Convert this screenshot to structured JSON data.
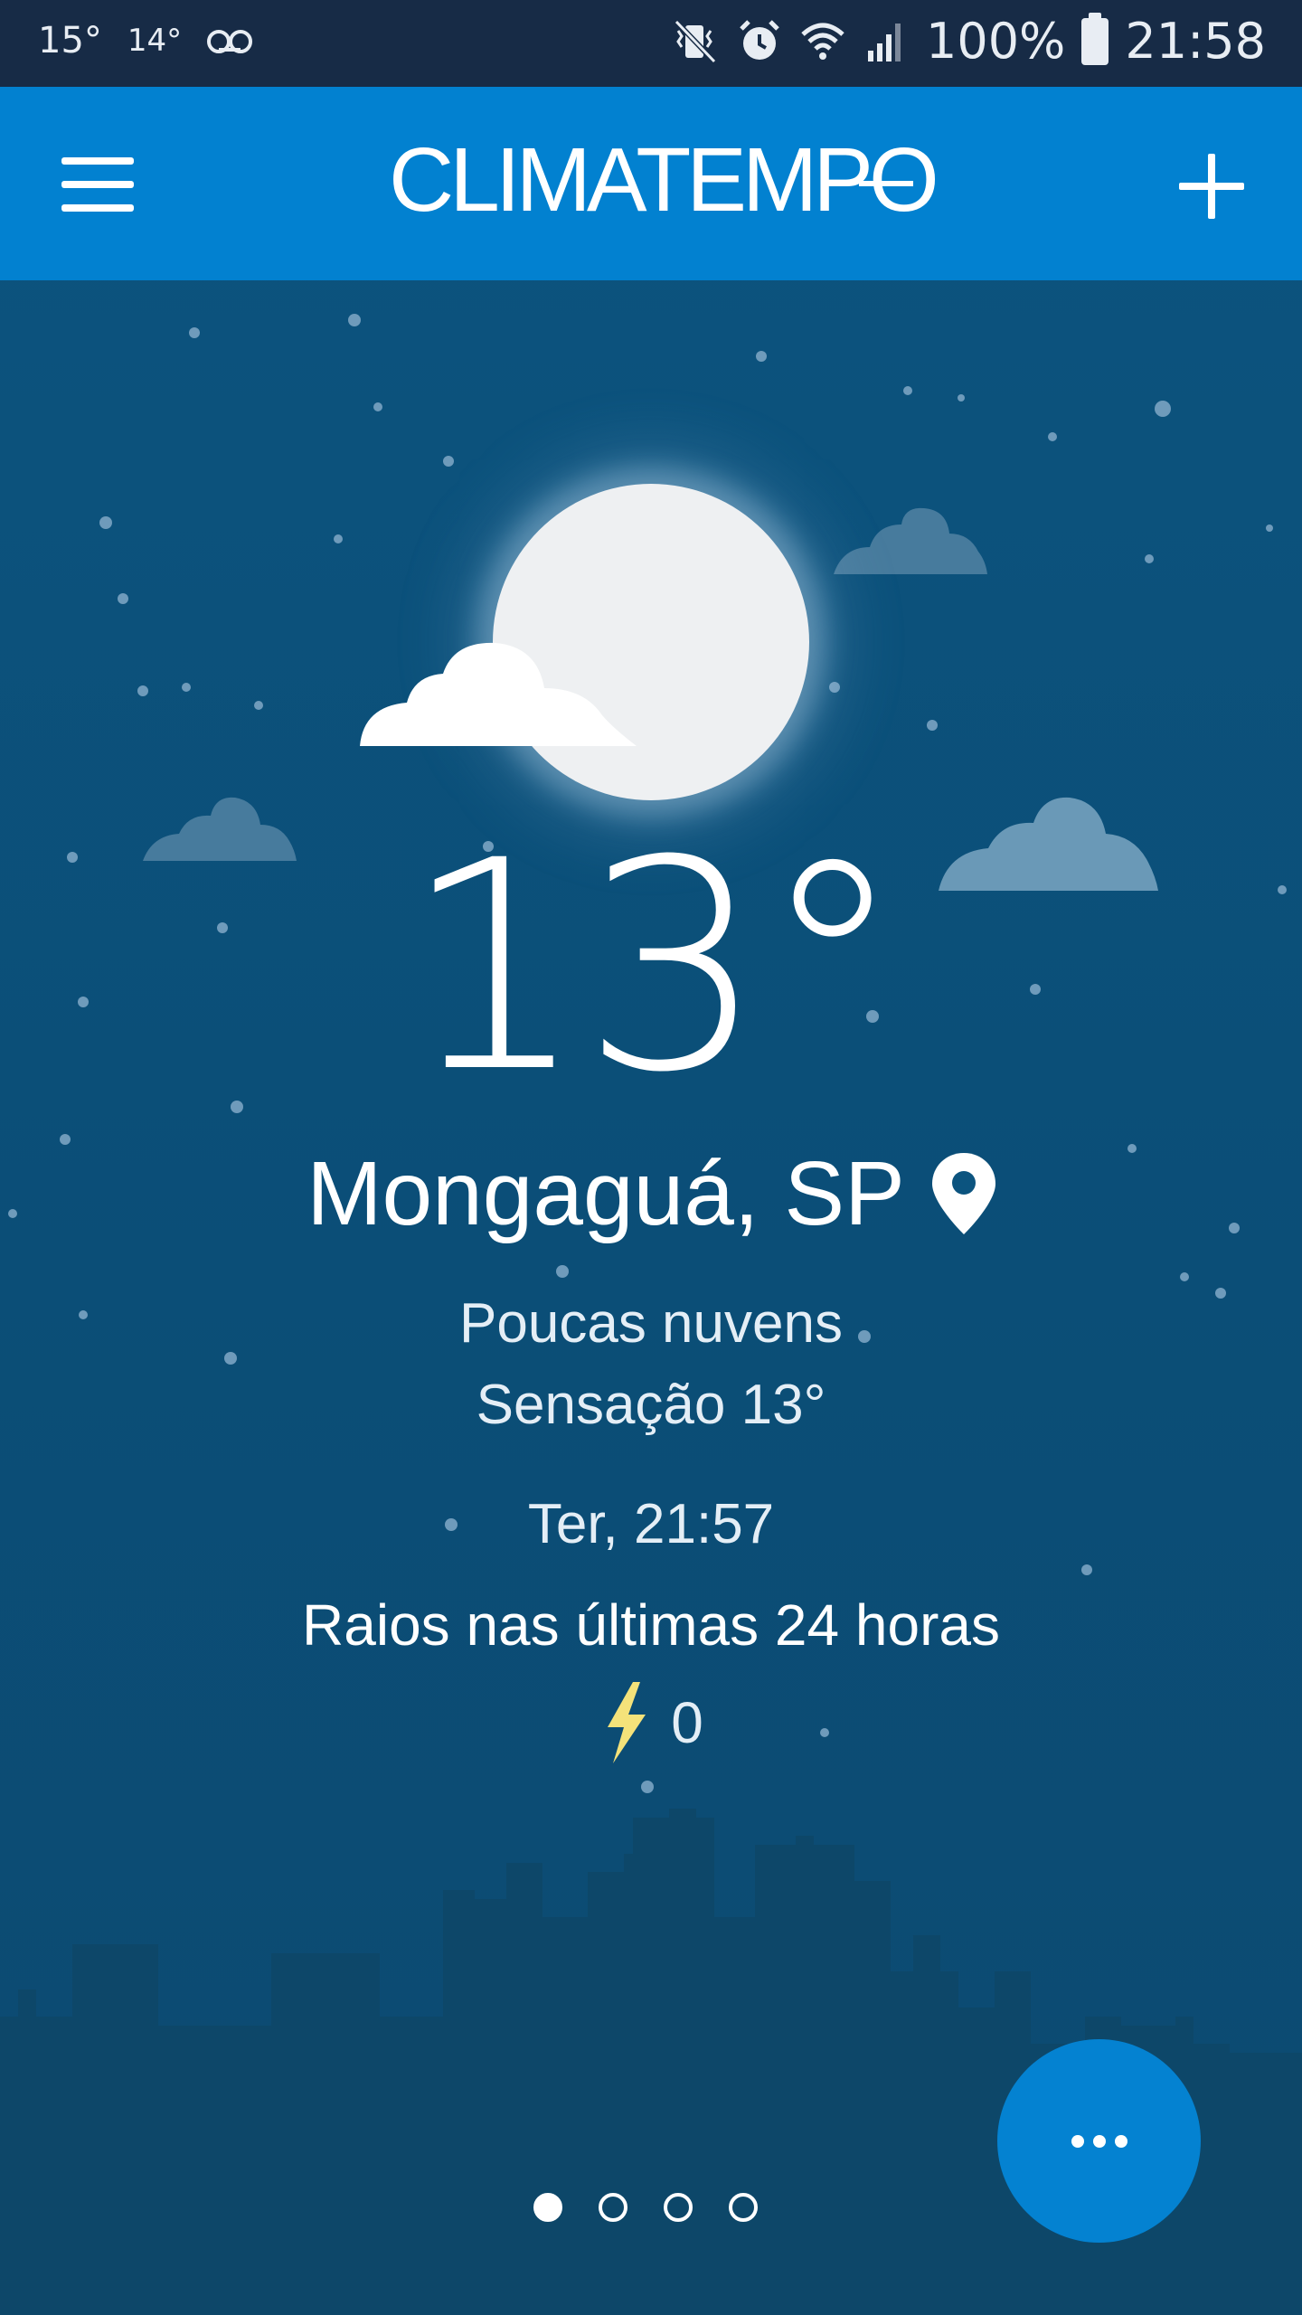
{
  "status_bar": {
    "temp1": "15°",
    "temp2": "14°",
    "voicemail_icon": "voicemail-icon",
    "battery": "100%",
    "time": "21:58",
    "icons": [
      "mute-vibrate-icon",
      "alarm-icon",
      "wifi-icon",
      "signal-icon",
      "battery-icon"
    ]
  },
  "app_bar": {
    "logo_text": "CLIMATEMPO",
    "menu_icon": "hamburger-icon",
    "add_icon": "plus-icon"
  },
  "weather": {
    "temperature": "13°",
    "city": "Mongaguá, SP",
    "condition": "Poucas nuvens",
    "feels_like": "Sensação 13°",
    "datetime": "Ter, 21:57",
    "lightning_title": "Raios nas últimas 24 horas",
    "lightning_count": "0"
  },
  "pager": {
    "pages": 4,
    "active_index": 0
  },
  "colors": {
    "status_bar": "#172b46",
    "app_bar": "#0281d0",
    "background": "#0c547f",
    "fab": "#0482d1",
    "bolt": "#f4e27a"
  }
}
